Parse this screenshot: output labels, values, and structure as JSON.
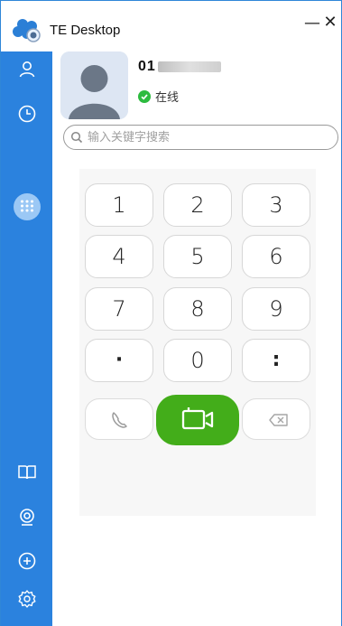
{
  "window": {
    "title": "TE Desktop",
    "minimize_glyph": "—",
    "close_glyph": "✕"
  },
  "sidebar": {
    "items": [
      {
        "name": "contacts",
        "icon": "person-icon"
      },
      {
        "name": "history",
        "icon": "clock-icon"
      },
      {
        "name": "dialpad",
        "icon": "dialpad-icon",
        "active": true
      }
    ],
    "bottom_items": [
      {
        "name": "directory",
        "icon": "book-icon"
      },
      {
        "name": "camera",
        "icon": "webcam-icon"
      },
      {
        "name": "add",
        "icon": "plus-circle-icon"
      },
      {
        "name": "settings",
        "icon": "gear-icon"
      }
    ]
  },
  "profile": {
    "number_prefix": "01",
    "status": "在线"
  },
  "search": {
    "placeholder": "输入关键字搜索"
  },
  "dialpad": {
    "keys": [
      "1",
      "2",
      "3",
      "4",
      "5",
      "6",
      "7",
      "8",
      "9",
      "·",
      "0",
      ":"
    ]
  },
  "actions": [
    "audio-call",
    "video-call",
    "backspace"
  ],
  "colors": {
    "sidebar": "#2b82de",
    "active_tab": "#9bc8f5",
    "video_call": "#43ad1a",
    "online": "#2dbb3f"
  }
}
